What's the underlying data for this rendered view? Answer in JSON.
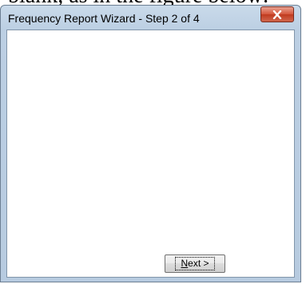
{
  "background_text": "blank, as in the figure below:",
  "window": {
    "title": "Frequency Report Wizard - Step 2 of 4",
    "close_icon": "close-x-icon",
    "close_color": "#c8452a"
  },
  "footer": {
    "next_button": {
      "mnemonic": "N",
      "label_rest": "ext >"
    }
  }
}
